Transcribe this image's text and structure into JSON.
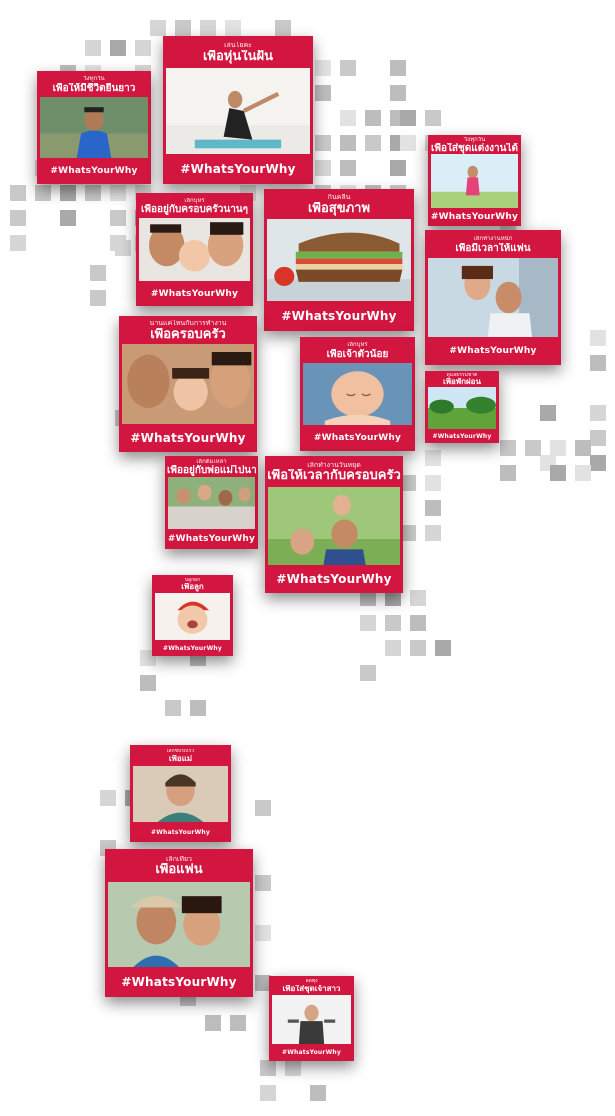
{
  "hashtag": "#WhatsYourWhy",
  "colors": {
    "brand": "#d2163f",
    "background": "#ffffff",
    "tile_grey": "#c4c4c4"
  },
  "cards": [
    {
      "id": "card-long-life",
      "sub": "วิ่งทุกวัน",
      "main": "เพื่อให้มีชีวิตยืนยาว",
      "photo": "runner-man"
    },
    {
      "id": "card-yoga",
      "sub": "เล่นโยคะ",
      "main": "เพื่อหุ่นในฝัน",
      "photo": "yoga-woman"
    },
    {
      "id": "card-work-outfit",
      "sub": "วิ่งทุกวัน",
      "main": "เพื่อใส่ชุดแต่งงานได้",
      "photo": "jogging-woman"
    },
    {
      "id": "card-family-kiss",
      "sub": "เลิกบุหรี่",
      "main": "เพื่ออยู่กับครอบครัวนานๆ",
      "photo": "family-kiss"
    },
    {
      "id": "card-health",
      "sub": "กินคลีน",
      "main": "เพื่อสุขภาพ",
      "photo": "healthy-sandwich"
    },
    {
      "id": "card-time-with-partner",
      "sub": "เลิกทำงานหนัก",
      "main": "เพื่อมีเวลาให้แฟน",
      "photo": "couple-piggyback"
    },
    {
      "id": "card-for-family",
      "sub": "นานแค่ไหนกับการทำงาน",
      "main": "เพื่อครอบครัว",
      "photo": "grandma-baby"
    },
    {
      "id": "card-little-one",
      "sub": "เลิกบุหรี่",
      "main": "เพื่อเจ้าตัวน้อย",
      "photo": "sleeping-baby"
    },
    {
      "id": "card-parks",
      "sub": "ดูแลธรรมชาติ",
      "main": "เพื่อพักผ่อน",
      "photo": "green-park"
    },
    {
      "id": "card-elders",
      "sub": "เลิกดื่มเหล้า",
      "main": "เพื่ออยู่กับพ่อแม่ไปนานๆ",
      "photo": "elder-group"
    },
    {
      "id": "card-family-time",
      "sub": "เลิกทำงานวันหยุด",
      "main": "เพื่อให้เวลากับครอบครัว",
      "photo": "dad-kids-park"
    },
    {
      "id": "card-for-child",
      "sub": "ปลูกผัก",
      "main": "เพื่อลูก",
      "photo": "laughing-baby"
    },
    {
      "id": "card-for-mother",
      "sub": "เลิกขับรถเร็ว",
      "main": "เพื่อแม่",
      "photo": "older-woman"
    },
    {
      "id": "card-for-partner",
      "sub": "เลิกเที่ยว",
      "main": "เพื่อแฟน",
      "photo": "couple-smile"
    },
    {
      "id": "card-wedding-dress",
      "sub": "ลดพุง",
      "main": "เพื่อใส่ชุดเจ้าสาว",
      "photo": "fitness-woman"
    }
  ]
}
